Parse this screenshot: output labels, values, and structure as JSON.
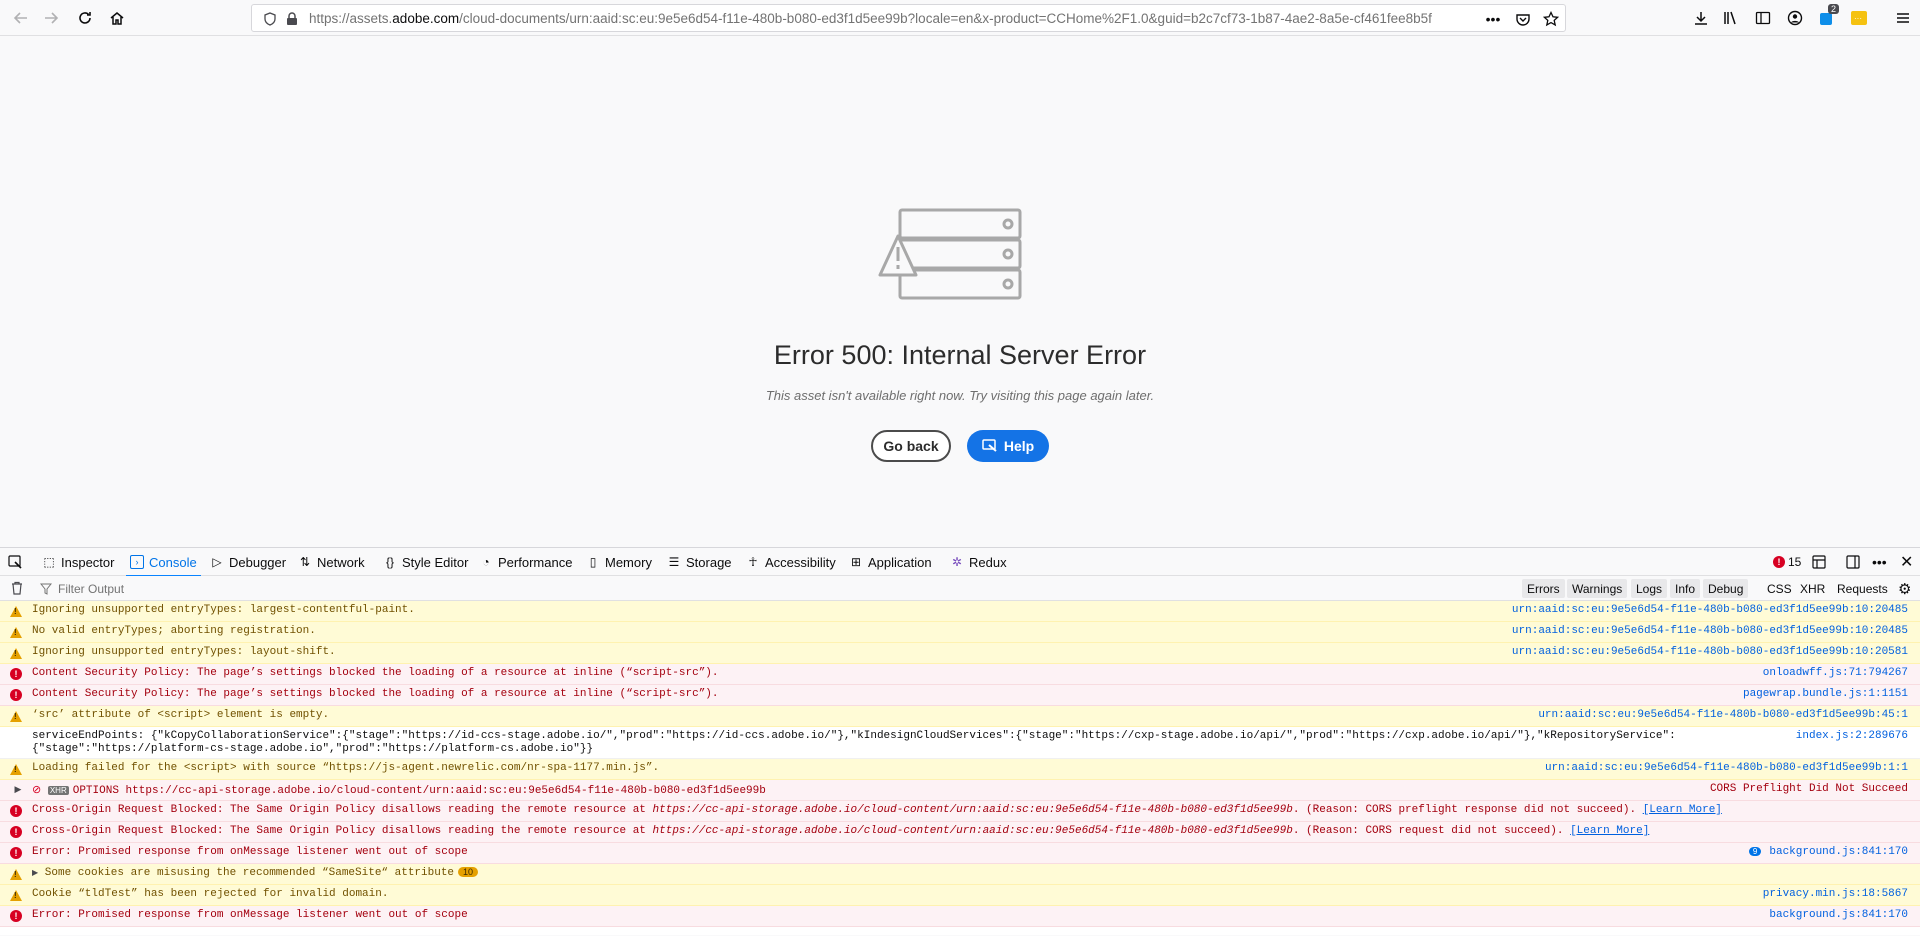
{
  "browser": {
    "url_prefix": "https://assets.",
    "url_host": "adobe.com",
    "url_rest": "/cloud-documents/urn:aaid:sc:eu:9e5e6d54-f11e-480b-b080-ed3f1d5ee99b?locale=en&x-product=CCHome%2F1.0&guid=b2c7cf73-1b87-4ae2-8a5e-cf461fee8b5f",
    "ext_badge": "2"
  },
  "page": {
    "error_title": "Error 500: Internal Server Error",
    "error_subtitle": "This asset isn't available right now. Try visiting this page again later.",
    "back_label": "Go back",
    "help_label": "Help"
  },
  "devtools": {
    "tabs": [
      {
        "label": "Inspector",
        "icon": "inspector-icon"
      },
      {
        "label": "Console",
        "icon": "console-icon",
        "active": true
      },
      {
        "label": "Debugger",
        "icon": "debugger-icon"
      },
      {
        "label": "Network",
        "icon": "network-icon"
      },
      {
        "label": "Style Editor",
        "icon": "style-editor-icon"
      },
      {
        "label": "Performance",
        "icon": "performance-icon"
      },
      {
        "label": "Memory",
        "icon": "memory-icon"
      },
      {
        "label": "Storage",
        "icon": "storage-icon"
      },
      {
        "label": "Accessibility",
        "icon": "accessibility-icon"
      },
      {
        "label": "Application",
        "icon": "application-icon"
      },
      {
        "label": "Redux",
        "icon": "redux-icon"
      }
    ],
    "error_count": "15",
    "filter_placeholder": "Filter Output",
    "filters": [
      "Errors",
      "Warnings",
      "Logs",
      "Info",
      "Debug"
    ],
    "filters_plain": [
      "CSS",
      "XHR",
      "Requests"
    ],
    "logs": [
      {
        "type": "warn",
        "msg": "Ignoring unsupported entryTypes: largest-contentful-paint.",
        "src": "urn:aaid:sc:eu:9e5e6d54-f11e-480b-b080-ed3f1d5ee99b:10:20485"
      },
      {
        "type": "warn",
        "msg": "No valid entryTypes; aborting registration.",
        "src": "urn:aaid:sc:eu:9e5e6d54-f11e-480b-b080-ed3f1d5ee99b:10:20485"
      },
      {
        "type": "warn",
        "msg": "Ignoring unsupported entryTypes: layout-shift.",
        "src": "urn:aaid:sc:eu:9e5e6d54-f11e-480b-b080-ed3f1d5ee99b:10:20581"
      },
      {
        "type": "error",
        "msg": "Content Security Policy: The page’s settings blocked the loading of a resource at inline (“script-src”).",
        "src": "onloadwff.js:71:794267"
      },
      {
        "type": "error",
        "msg": "Content Security Policy: The page’s settings blocked the loading of a resource at inline (“script-src”).",
        "src": "pagewrap.bundle.js:1:1151"
      },
      {
        "type": "warn",
        "msg": "‘src’ attribute of <script> element is empty.",
        "src": "urn:aaid:sc:eu:9e5e6d54-f11e-480b-b080-ed3f1d5ee99b:45:1"
      },
      {
        "type": "log",
        "msg": "serviceEndPoints: {\"kCopyCollaborationService\":{\"stage\":\"https://id-ccs-stage.adobe.io/\",\"prod\":\"https://id-ccs.adobe.io/\"},\"kIndesignCloudServices\":{\"stage\":\"https://cxp-stage.adobe.io/api/\",\"prod\":\"https://cxp.adobe.io/api/\"},\"kRepositoryService\":{\"stage\":\"https://platform-cs-stage.adobe.io\",\"prod\":\"https://platform-cs.adobe.io\"}}",
        "src": "index.js:2:289676"
      },
      {
        "type": "warn",
        "msg": "Loading failed for the <script> with source “https://js-agent.newrelic.com/nr-spa-1177.min.js”.",
        "src": "urn:aaid:sc:eu:9e5e6d54-f11e-480b-b080-ed3f1d5ee99b:1:1"
      },
      {
        "type": "error-xhr",
        "method": "OPTIONS",
        "xhr": "XHR",
        "msg": "https://cc-api-storage.adobe.io/cloud-content/urn:aaid:sc:eu:9e5e6d54-f11e-480b-b080-ed3f1d5ee99b",
        "src": "CORS Preflight Did Not Succeed"
      },
      {
        "type": "error",
        "msg_a": "Cross-Origin Request Blocked: The Same Origin Policy disallows reading the remote resource at ",
        "msg_b": "https://cc-api-storage.adobe.io/cloud-content/urn:aaid:sc:eu:9e5e6d54-f11e-480b-b080-ed3f1d5ee99b",
        "msg_c": ". (Reason: CORS preflight response did not succeed). ",
        "link": "[Learn More]"
      },
      {
        "type": "error",
        "msg_a": "Cross-Origin Request Blocked: The Same Origin Policy disallows reading the remote resource at ",
        "msg_b": "https://cc-api-storage.adobe.io/cloud-content/urn:aaid:sc:eu:9e5e6d54-f11e-480b-b080-ed3f1d5ee99b",
        "msg_c": ". (Reason: CORS request did not succeed). ",
        "link": "[Learn More]"
      },
      {
        "type": "error",
        "msg": "Error: Promised response from onMessage listener went out of scope",
        "badge": "9",
        "src": "background.js:841:170"
      },
      {
        "type": "warn-group",
        "msg": "Some cookies are misusing the recommended “SameSite“ attribute",
        "badge": "10"
      },
      {
        "type": "warn",
        "msg": "Cookie “tldTest” has been rejected for invalid domain.",
        "src": "privacy.min.js:18:5867"
      },
      {
        "type": "error",
        "msg": "Error: Promised response from onMessage listener went out of scope",
        "src": "background.js:841:170"
      }
    ]
  }
}
